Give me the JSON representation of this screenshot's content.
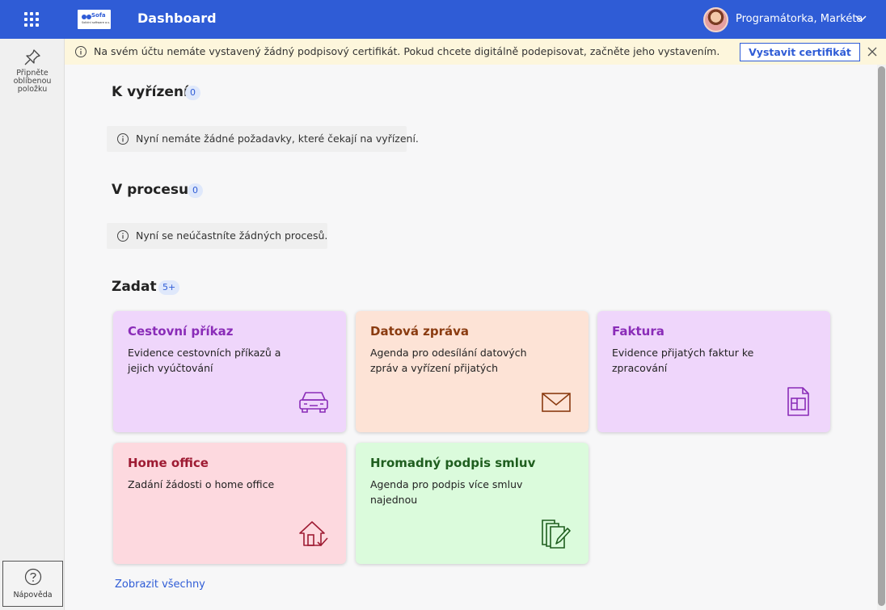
{
  "topbar": {
    "logo_brand": "Sofa",
    "logo_sub": "Solidní software a.s.",
    "title": "Dashboard",
    "user_name": "Programátorka, Markéta"
  },
  "sidebar": {
    "pin_label": "Připněte oblíbenou položku",
    "help_label": "Nápověda"
  },
  "banner": {
    "text": "Na svém účtu nemáte vystavený žádný podpisový certifikát. Pokud chcete digitálně podepisovat, začněte jeho vystavením.",
    "button_label": "Vystavit certifikát"
  },
  "sections": {
    "pending": {
      "title": "K vyřízení",
      "count": "0",
      "notice": "Nyní nemáte žádné požadavky, které čekají na vyřízení."
    },
    "in_process": {
      "title": "V procesu",
      "count": "0",
      "notice": "Nyní se neúčastníte žádných procesů."
    },
    "create": {
      "title": "Zadat",
      "count": "5+"
    }
  },
  "cards": [
    {
      "title": "Cestovní příkaz",
      "description": "Evidence cestovních příkazů a jejich vyúčtování",
      "icon": "car-icon",
      "bg": "#efd6fb",
      "accent": "#8a2cb8"
    },
    {
      "title": "Datová zpráva",
      "description": "Agenda pro odesílání datových zpráv a vyřízení přijatých",
      "icon": "envelope-icon",
      "bg": "#fde3d6",
      "accent": "#8a3b10"
    },
    {
      "title": "Faktura",
      "description": "Evidence přijatých faktur ke zpracování",
      "icon": "invoice-icon",
      "bg": "#efd6fb",
      "accent": "#8a2cb8"
    },
    {
      "title": "Home office",
      "description": "Zadání žádosti o home office",
      "icon": "home-check-icon",
      "bg": "#fdd9df",
      "accent": "#9e1b33"
    },
    {
      "title": "Hromadný podpis smluv",
      "description": "Agenda pro podpis více smluv najednou",
      "icon": "documents-sign-icon",
      "bg": "#dbfbdc",
      "accent": "#1f5e1f"
    }
  ],
  "show_all_label": "Zobrazit všechny"
}
